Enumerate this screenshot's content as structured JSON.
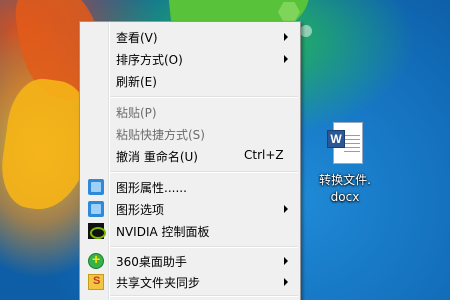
{
  "desktop": {
    "icon": {
      "label": "转换文件.\ndocx",
      "badge": "W",
      "icon_name": "word-document-icon"
    }
  },
  "context_menu": {
    "items": [
      {
        "label": "查看(V)",
        "submenu": true
      },
      {
        "label": "排序方式(O)",
        "submenu": true
      },
      {
        "label": "刷新(E)"
      },
      {
        "label": "粘贴(P)",
        "disabled": true
      },
      {
        "label": "粘贴快捷方式(S)",
        "disabled": true
      },
      {
        "label": "撤消 重命名(U)",
        "shortcut": "Ctrl+Z"
      },
      {
        "label": "图形属性......",
        "icon": "graphics-properties-icon"
      },
      {
        "label": "图形选项",
        "icon": "graphics-options-icon",
        "submenu": true
      },
      {
        "label": "NVIDIA 控制面板",
        "icon": "nvidia-icon"
      },
      {
        "label": "360桌面助手",
        "icon": "360-desktop-icon",
        "submenu": true
      },
      {
        "label": "共享文件夹同步",
        "icon": "shared-folder-sync-icon",
        "submenu": true
      }
    ]
  },
  "colors": {
    "menu_background": "#f0f0f0",
    "menu_border": "#979797",
    "disabled_text": "#6d6d6d"
  }
}
